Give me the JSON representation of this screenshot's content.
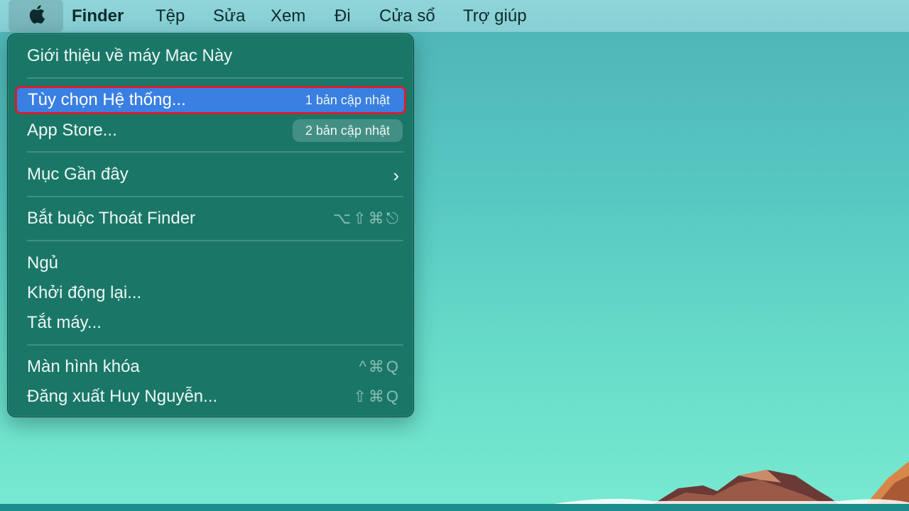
{
  "menubar": {
    "apple_icon": "apple-logo-icon",
    "items": [
      "Finder",
      "Tệp",
      "Sửa",
      "Xem",
      "Đi",
      "Cửa sổ",
      "Trợ giúp"
    ]
  },
  "apple_menu": {
    "about": "Giới thiệu về máy Mac Này",
    "system_prefs": {
      "label": "Tùy chọn Hệ thống...",
      "badge": "1 bản cập nhật"
    },
    "app_store": {
      "label": "App Store...",
      "badge": "2 bản cập nhật"
    },
    "recent": {
      "label": "Mục Gần đây",
      "chevron": "›"
    },
    "force_quit": {
      "label": "Bắt buộc Thoát Finder",
      "shortcut": "⌥⇧⌘⎋"
    },
    "sleep": "Ngủ",
    "restart": "Khởi động lại...",
    "shutdown": "Tắt máy...",
    "lock_screen": {
      "label": "Màn hình khóa",
      "shortcut": "^⌘Q"
    },
    "logout": {
      "label": "Đăng xuất Huy Nguyễn...",
      "shortcut": "⇧⌘Q"
    }
  },
  "colors": {
    "menu_background": "#1a7768",
    "highlight": "#3a7fe2",
    "highlight_border": "#d5202a",
    "menubar": "#8fd5da"
  }
}
